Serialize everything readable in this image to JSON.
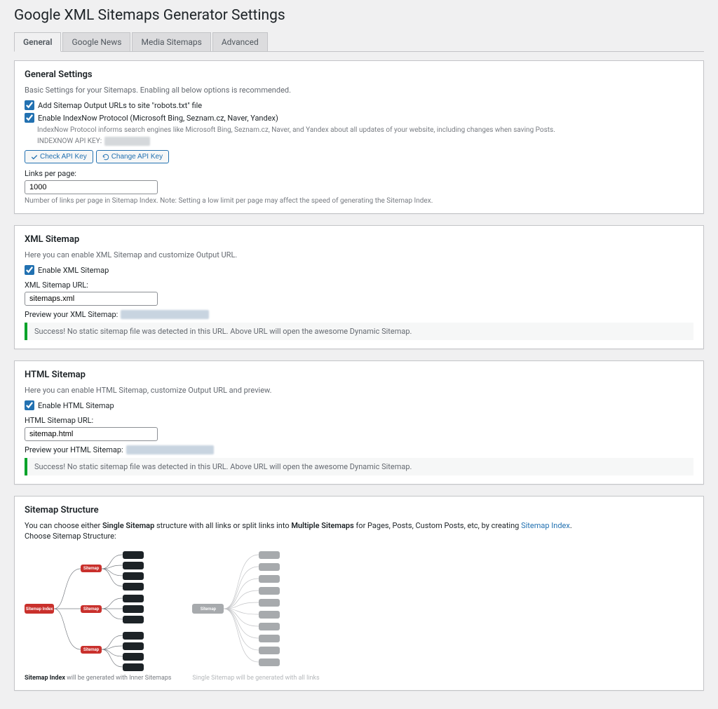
{
  "page_title": "Google XML Sitemaps Generator Settings",
  "tabs": [
    "General",
    "Google News",
    "Media Sitemaps",
    "Advanced"
  ],
  "general": {
    "title": "General Settings",
    "desc": "Basic Settings for your Sitemaps. Enabling all below options is recommended.",
    "cb_robots": "Add Sitemap Output URLs to site \"robots.txt\" file",
    "cb_indexnow": "Enable IndexNow Protocol (Microsoft Bing, Seznam.cz, Naver, Yandex)",
    "indexnow_desc": "IndexNow Protocol informs search engines like Microsoft Bing, Seznam.cz, Naver, and Yandex about all updates of your website, including changes when saving Posts.",
    "apikey_label": "INDEXNOW API KEY:",
    "btn_check": "Check API Key",
    "btn_change": "Change API Key",
    "links_label": "Links per page:",
    "links_value": "1000",
    "links_help": "Number of links per page in Sitemap Index. Note: Setting a low limit per page may affect the speed of generating the Sitemap Index."
  },
  "xml": {
    "title": "XML Sitemap",
    "desc": "Here you can enable XML Sitemap and customize Output URL.",
    "cb_enable": "Enable XML Sitemap",
    "url_label": "XML Sitemap URL:",
    "url_value": "sitemaps.xml",
    "preview_label": "Preview your XML Sitemap:",
    "success": "Success! No static sitemap file was detected in this URL. Above URL will open the awesome Dynamic Sitemap."
  },
  "html": {
    "title": "HTML Sitemap",
    "desc": "Here you can enable HTML Sitemap, customize Output URL and preview.",
    "cb_enable": "Enable HTML Sitemap",
    "url_label": "HTML Sitemap URL:",
    "url_value": "sitemap.html",
    "preview_label": "Preview your HTML Sitemap:",
    "success": "Success! No static sitemap file was detected in this URL. Above URL will open the awesome Dynamic Sitemap."
  },
  "structure": {
    "title": "Sitemap Structure",
    "text_pre": "You can choose either ",
    "single_b": "Single Sitemap",
    "text_mid1": " structure with all links or split links into ",
    "multiple_b": "Multiple Sitemaps",
    "text_mid2": " for Pages, Posts, Custom Posts, etc, by creating ",
    "index_link": "Sitemap Index",
    "text_end": ".",
    "choose": "Choose Sitemap Structure:",
    "diag1_root": "Sitemap Index",
    "diag1_mid": "Sitemap",
    "diag1_cap_b": "Sitemap Index",
    "diag1_cap": " will be generated with Inner Sitemaps",
    "diag2_root": "Sitemap",
    "diag2_cap": "Single Sitemap will be generated with all links"
  }
}
